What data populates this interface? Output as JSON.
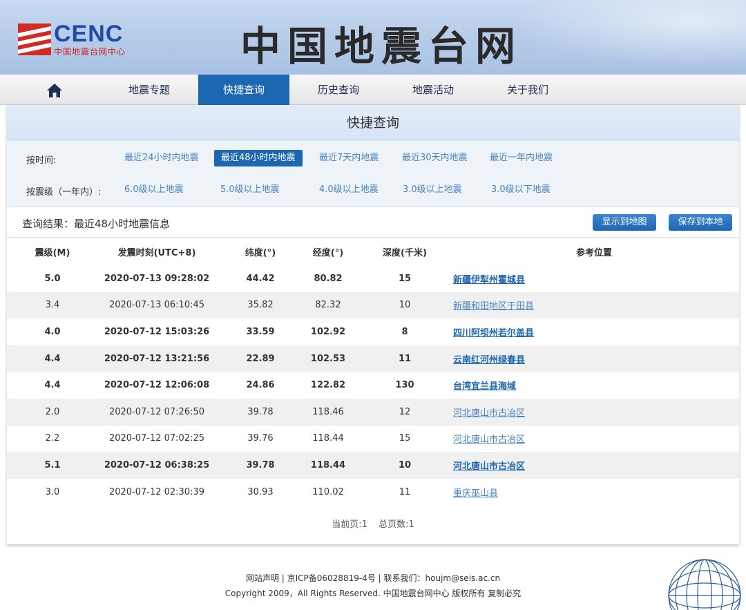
{
  "header": {
    "logo_text": "CENC",
    "logo_sub": "中国地震台网中心",
    "site_title": "中国地震台网"
  },
  "nav": {
    "home_icon": "home-icon",
    "items": [
      {
        "label": "地震专题",
        "active": false
      },
      {
        "label": "快捷查询",
        "active": true
      },
      {
        "label": "历史查询",
        "active": false
      },
      {
        "label": "地震活动",
        "active": false
      },
      {
        "label": "关于我们",
        "active": false
      }
    ]
  },
  "panel": {
    "title": "快捷查询",
    "by_time_label": "按时间:",
    "by_time": [
      {
        "label": "最近24小时内地震",
        "active": false
      },
      {
        "label": "最近48小时内地震",
        "active": true
      },
      {
        "label": "最近7天内地震",
        "active": false
      },
      {
        "label": "最近30天内地震",
        "active": false
      },
      {
        "label": "最近一年内地震",
        "active": false
      }
    ],
    "by_mag_label": "按震级（一年内）:",
    "by_mag": [
      {
        "label": "6.0级以上地震"
      },
      {
        "label": "5.0级以上地震"
      },
      {
        "label": "4.0级以上地震"
      },
      {
        "label": "3.0级以上地震"
      },
      {
        "label": "3.0级以下地震"
      }
    ],
    "result_label": "查询结果：最近48小时地震信息",
    "map_button": "显示到地图",
    "save_button": "保存到本地"
  },
  "table": {
    "headers": [
      "震级(M)",
      "发震时刻(UTC+8)",
      "纬度(°)",
      "经度(°)",
      "深度(千米)",
      "参考位置"
    ],
    "rows": [
      {
        "mag": "5.0",
        "time": "2020-07-13 09:28:02",
        "lat": "44.42",
        "lon": "80.82",
        "depth": "15",
        "loc": "新疆伊犁州霍城县",
        "bold": true
      },
      {
        "mag": "3.4",
        "time": "2020-07-13 06:10:45",
        "lat": "35.82",
        "lon": "82.32",
        "depth": "10",
        "loc": "新疆和田地区于田县",
        "bold": false
      },
      {
        "mag": "4.0",
        "time": "2020-07-12 15:03:26",
        "lat": "33.59",
        "lon": "102.92",
        "depth": "8",
        "loc": "四川阿坝州若尔盖县",
        "bold": true
      },
      {
        "mag": "4.4",
        "time": "2020-07-12 13:21:56",
        "lat": "22.89",
        "lon": "102.53",
        "depth": "11",
        "loc": "云南红河州绿春县",
        "bold": true
      },
      {
        "mag": "4.4",
        "time": "2020-07-12 12:06:08",
        "lat": "24.86",
        "lon": "122.82",
        "depth": "130",
        "loc": "台湾宜兰县海域",
        "bold": true
      },
      {
        "mag": "2.0",
        "time": "2020-07-12 07:26:50",
        "lat": "39.78",
        "lon": "118.46",
        "depth": "12",
        "loc": "河北唐山市古冶区",
        "bold": false
      },
      {
        "mag": "2.2",
        "time": "2020-07-12 07:02:25",
        "lat": "39.76",
        "lon": "118.44",
        "depth": "15",
        "loc": "河北唐山市古冶区",
        "bold": false
      },
      {
        "mag": "5.1",
        "time": "2020-07-12 06:38:25",
        "lat": "39.78",
        "lon": "118.44",
        "depth": "10",
        "loc": "河北唐山市古冶区",
        "bold": true
      },
      {
        "mag": "3.0",
        "time": "2020-07-12 02:30:39",
        "lat": "30.93",
        "lon": "110.02",
        "depth": "11",
        "loc": "重庆巫山县",
        "bold": false
      }
    ]
  },
  "pager": {
    "current": "当前页:1",
    "total": "总页数:1"
  },
  "footer": {
    "line1": "网站声明 | 京ICP备06028819-4号 | 联系我们：houjm@seis.ac.cn",
    "line2": "Copyright 2009，All Rights Reserved. 中国地震台网中心 版权所有 复制必究"
  },
  "colors": {
    "accent": "#1d67b0",
    "link": "#4a84c0",
    "logo_blue": "#1e4aa8",
    "logo_red": "#c8201e"
  }
}
